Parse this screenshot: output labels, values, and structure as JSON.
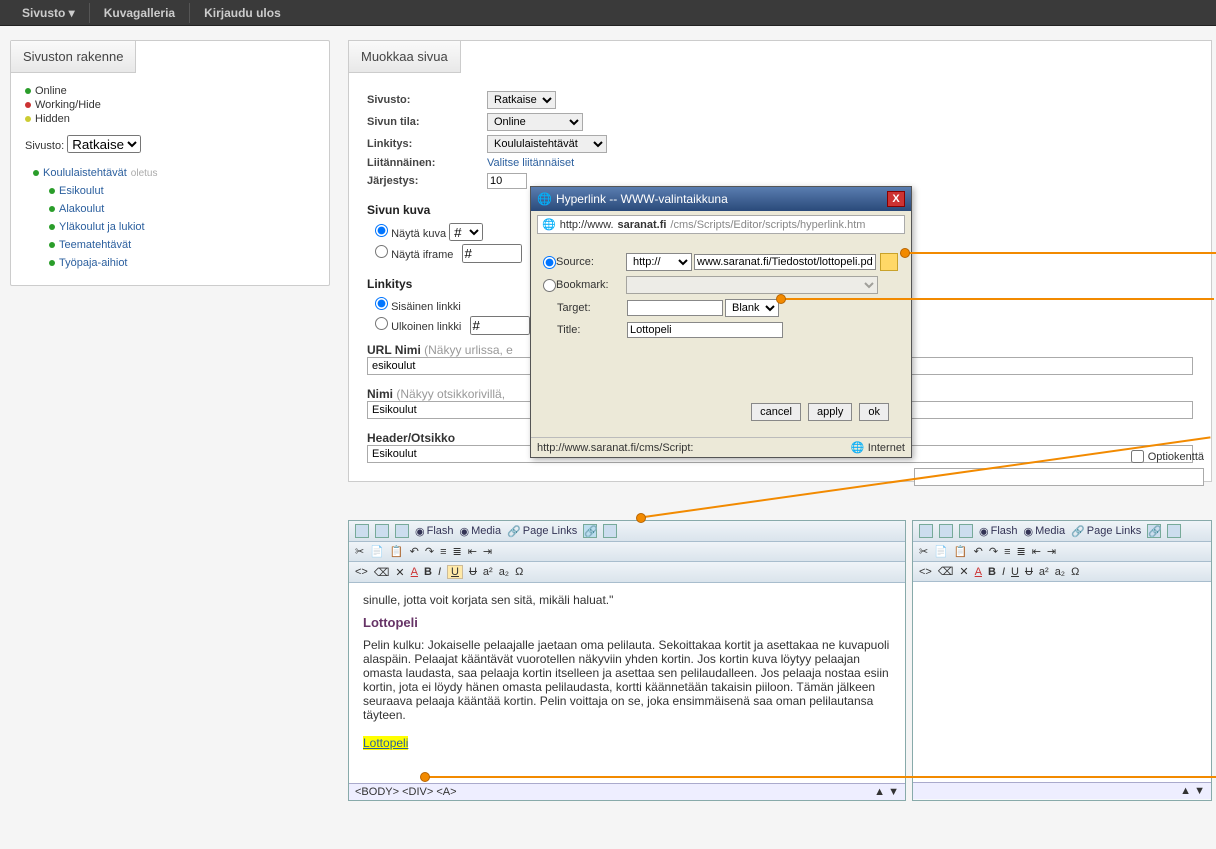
{
  "topnav": {
    "sivusto": "Sivusto",
    "kuvagalleria": "Kuvagalleria",
    "kirjaudu": "Kirjaudu ulos"
  },
  "left": {
    "tab": "Sivuston rakenne",
    "status_online": "Online",
    "status_working": "Working/Hide",
    "status_hidden": "Hidden",
    "sivusto_label": "Sivusto:",
    "sivusto_value": "Ratkaise",
    "tree": {
      "root": "Koululaistehtävät",
      "root_hint": "oletus",
      "children": [
        "Esikoulut",
        "Alakoulut",
        "Yläkoulut ja lukiot",
        "Teematehtävät",
        "Työpaja-aihiot"
      ]
    }
  },
  "main": {
    "tab": "Muokkaa sivua",
    "rows": {
      "sivusto": "Sivusto:",
      "sivusto_v": "Ratkaise",
      "tila": "Sivun tila:",
      "tila_v": "Online",
      "linkitys_lbl": "Linkitys:",
      "linkitys_v": "Koululaistehtävät",
      "liitannainen": "Liitännäinen:",
      "liitannainen_link": "Valitse liitännäiset",
      "jarjestys": "Järjestys:",
      "jarjestys_v": "10"
    },
    "kuva_h": "Sivun kuva",
    "nayta_kuva": "Näytä kuva",
    "nayta_iframe": "Näytä iframe",
    "iframe_val": "#",
    "kuva_sel": "#",
    "linkitys_h": "Linkitys",
    "sisainen": "Sisäinen linkki",
    "ulkoinen": "Ulkoinen linkki",
    "ulkoinen_val": "#",
    "url_nimi_lbl": "URL Nimi",
    "url_nimi_hint": "(Näkyy urlissa, e",
    "url_nimi_v": "esikoulut",
    "nimi_lbl": "Nimi",
    "nimi_hint": "(Näkyy otsikkorivillä,",
    "nimi_v": "Esikoulut",
    "header_lbl": "Header/Otsikko",
    "header_v": "Esikoulut",
    "optiokentta": "Optiokenttä"
  },
  "toolbar": {
    "flash": "Flash",
    "media": "Media",
    "pagelinks": "Page Links"
  },
  "editor": {
    "para1": "sinulle, jotta voit korjata sen sitä, mikäli haluat.\"",
    "heading": "Lottopeli",
    "para2": "Pelin kulku: Jokaiselle pelaajalle jaetaan oma pelilauta. Sekoittakaa kortit ja asettakaa ne kuvapuoli alaspäin. Pelaajat kääntävät vuorotellen näkyviin yhden kortin. Jos kortin kuva löytyy pelaajan omasta laudasta, saa pelaaja kortin itselleen ja asettaa sen pelilaudalleen. Jos pelaaja nostaa esiin kortin, jota ei löydy hänen omasta pelilaudasta, kortti käännetään takaisin piiloon. Tämän jälkeen seuraava pelaaja kääntää kortin. Pelin voittaja on se, joka ensimmäisenä saa oman pelilautansa täyteen.",
    "linktext": "Lottopeli",
    "status_path": "<BODY>  <DIV>  <A>"
  },
  "dialog": {
    "title": "Hyperlink -- WWW-valintaikkuna",
    "addr": "http://www.saranat.fi/cms/Scripts/Editor/scripts/hyperlink.htm",
    "source_lbl": "Source:",
    "source_proto": "http://",
    "source_url": "www.saranat.fi/Tiedostot/lottopeli.pdf",
    "bookmark_lbl": "Bookmark:",
    "target_lbl": "Target:",
    "target_v": "Blank",
    "title_lbl": "Title:",
    "title_v": "Lottopeli",
    "cancel": "cancel",
    "apply": "apply",
    "ok": "ok",
    "status_l": "http://www.saranat.fi/cms/Script:",
    "status_r": "Internet"
  }
}
